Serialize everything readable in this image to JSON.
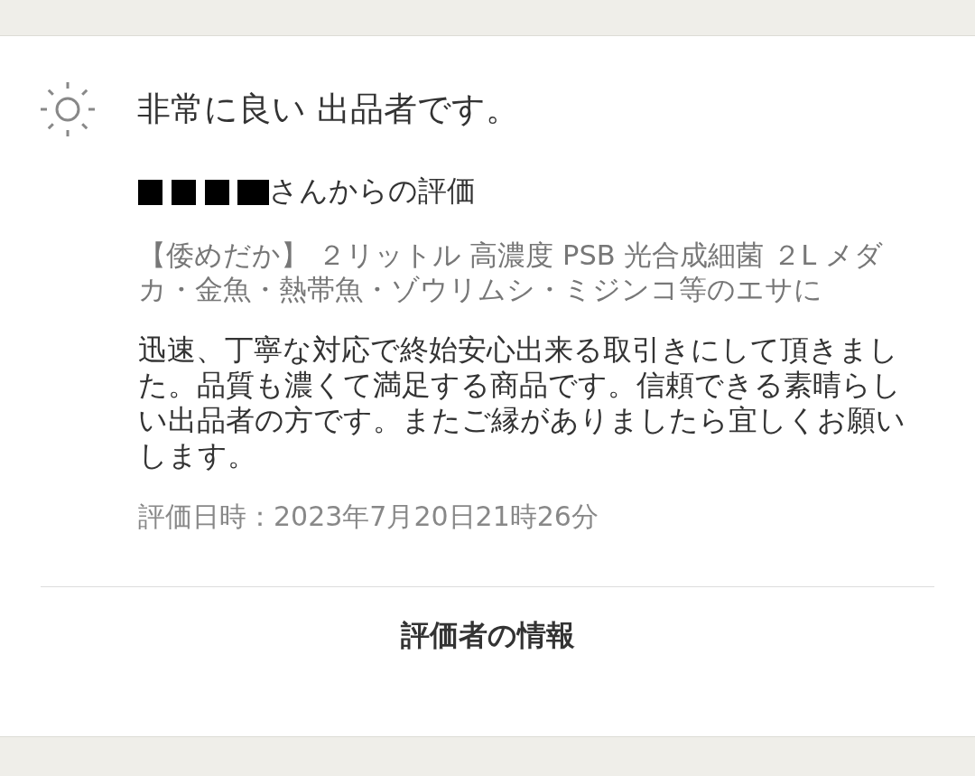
{
  "rating": {
    "title": "非常に良い 出品者です。"
  },
  "review": {
    "reviewer_suffix": "さんからの評価",
    "item": "【倭めだか】 ２リットル 高濃度 PSB 光合成細菌 ２L メダカ・金魚・熱帯魚・ゾウリムシ・ミジンコ等のエサに",
    "comment": "迅速、丁寧な対応で終始安心出来る取引きにして頂きました。品質も濃くて満足する商品です。信頼できる素晴らしい出品者の方です。またご縁がありましたら宜しくお願いします。",
    "date": "評価日時：2023年7月20日21時26分"
  },
  "footer_link": "評価者の情報"
}
